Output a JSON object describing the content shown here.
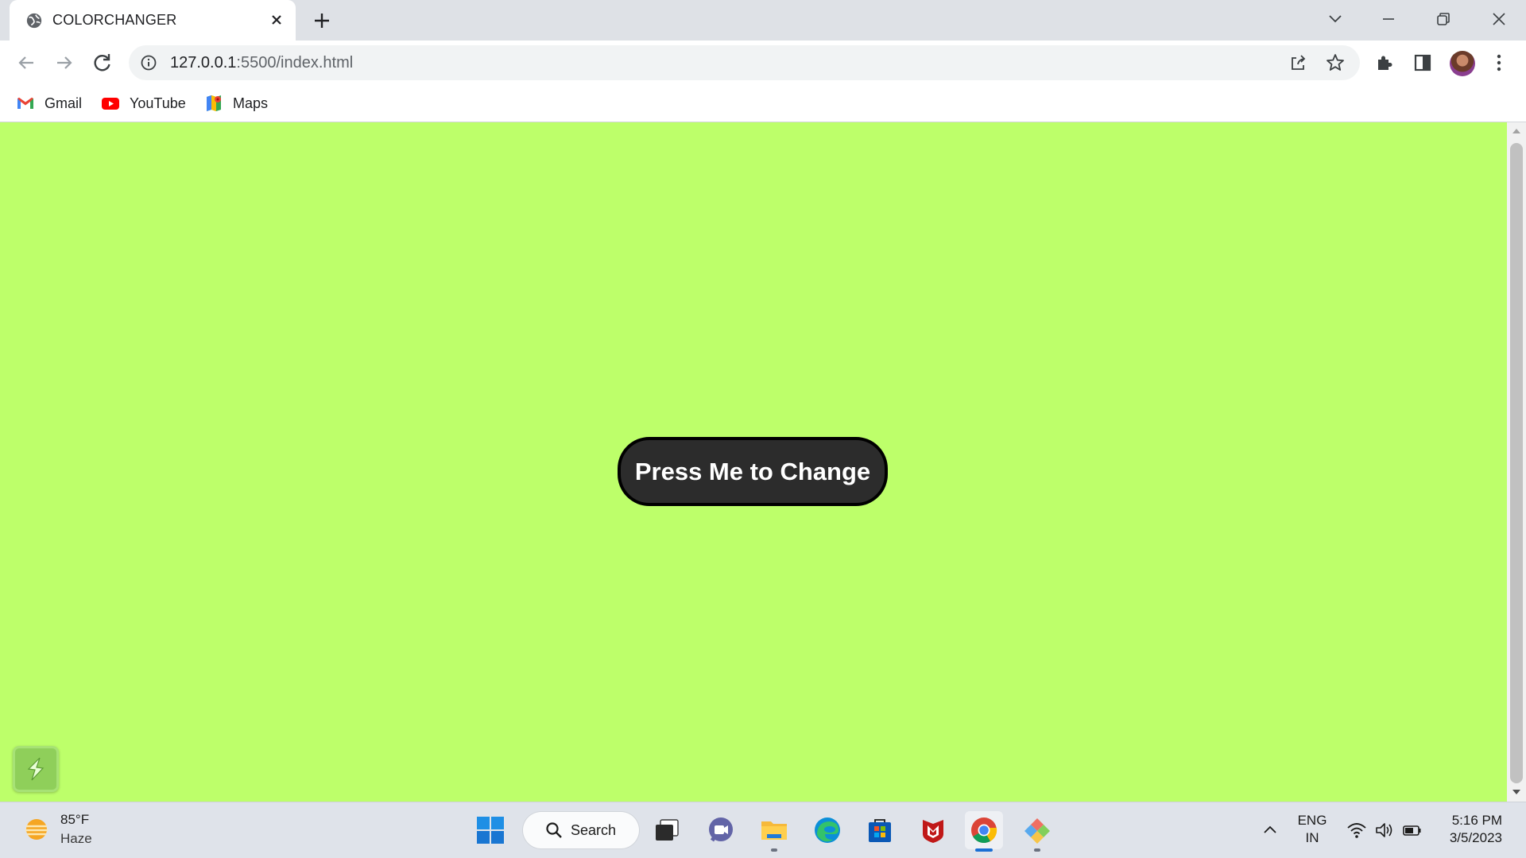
{
  "browser": {
    "tab": {
      "title": "COLORCHANGER",
      "favicon": "globe-icon"
    },
    "url": {
      "host": "127.0.0.1",
      "rest": ":5500/index.html"
    },
    "bookmarks": [
      {
        "label": "Gmail",
        "icon": "gmail-icon"
      },
      {
        "label": "YouTube",
        "icon": "youtube-icon"
      },
      {
        "label": "Maps",
        "icon": "maps-icon"
      }
    ]
  },
  "page": {
    "background": "#bdff6a",
    "button_label": "Press Me to Change",
    "button_color": "#2c2c2c"
  },
  "taskbar": {
    "weather": {
      "temp": "85°F",
      "condition": "Haze"
    },
    "search_label": "Search",
    "tray": {
      "lang": "ENG",
      "region": "IN",
      "time": "5:16 PM",
      "date": "3/5/2023"
    }
  }
}
